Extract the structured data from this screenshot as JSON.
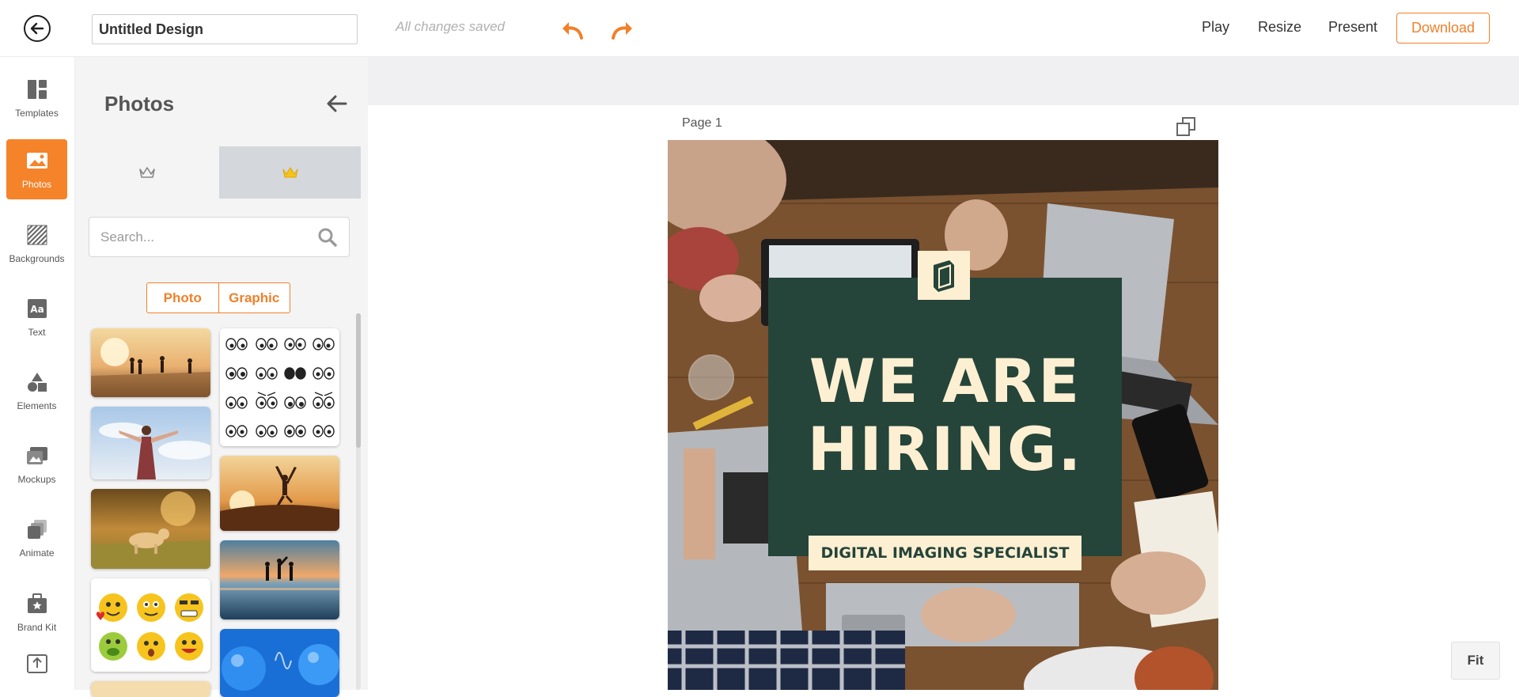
{
  "header": {
    "back_icon": "arrow-left-circle-icon",
    "design_title": "Untitled Design",
    "save_status": "All changes saved",
    "undo_icon": "undo-icon",
    "redo_icon": "redo-icon",
    "play_label": "Play",
    "resize_label": "Resize",
    "present_label": "Present",
    "download_label": "Download",
    "accent_color": "#f0802a"
  },
  "rail": {
    "items": [
      {
        "label": "Templates",
        "icon": "templates-icon",
        "active": false
      },
      {
        "label": "Photos",
        "icon": "photo-icon",
        "active": true
      },
      {
        "label": "Backgrounds",
        "icon": "backgrounds-icon",
        "active": false
      },
      {
        "label": "Text",
        "icon": "text-icon",
        "active": false
      },
      {
        "label": "Elements",
        "icon": "shapes-icon",
        "active": false
      },
      {
        "label": "Mockups",
        "icon": "mockups-icon",
        "active": false
      },
      {
        "label": "Animate",
        "icon": "animate-icon",
        "active": false
      },
      {
        "label": "Brand Kit",
        "icon": "brand-kit-icon",
        "active": false
      },
      {
        "label": "",
        "icon": "upload-icon",
        "active": false
      }
    ],
    "active_color": "#f5832a"
  },
  "panel": {
    "title": "Photos",
    "search_placeholder": "Search...",
    "tabs": [
      {
        "icon": "crown-outline-icon",
        "selected": false
      },
      {
        "icon": "crown-filled-icon",
        "selected": true
      }
    ],
    "filter_photo": "Photo",
    "filter_graphic": "Graphic",
    "thumbnails_left": [
      "people-running-sunset",
      "woman-arms-open-sky",
      "dog-running-field",
      "emoji-faces",
      "partial-thumbnail"
    ],
    "thumbnails_right": [
      "cartoon-eyes-grid",
      "woman-jumping-sunset",
      "friends-beach-sunset",
      "blue-balloons"
    ]
  },
  "canvas": {
    "page_label": "Page 1",
    "headline_line1": "WE ARE",
    "headline_line2": "HIRING.",
    "subtag": "DIGITAL IMAGING SPECIALIST",
    "fit_label": "Fit",
    "green_color": "#25443a",
    "cream_color": "#fdf0d2"
  }
}
